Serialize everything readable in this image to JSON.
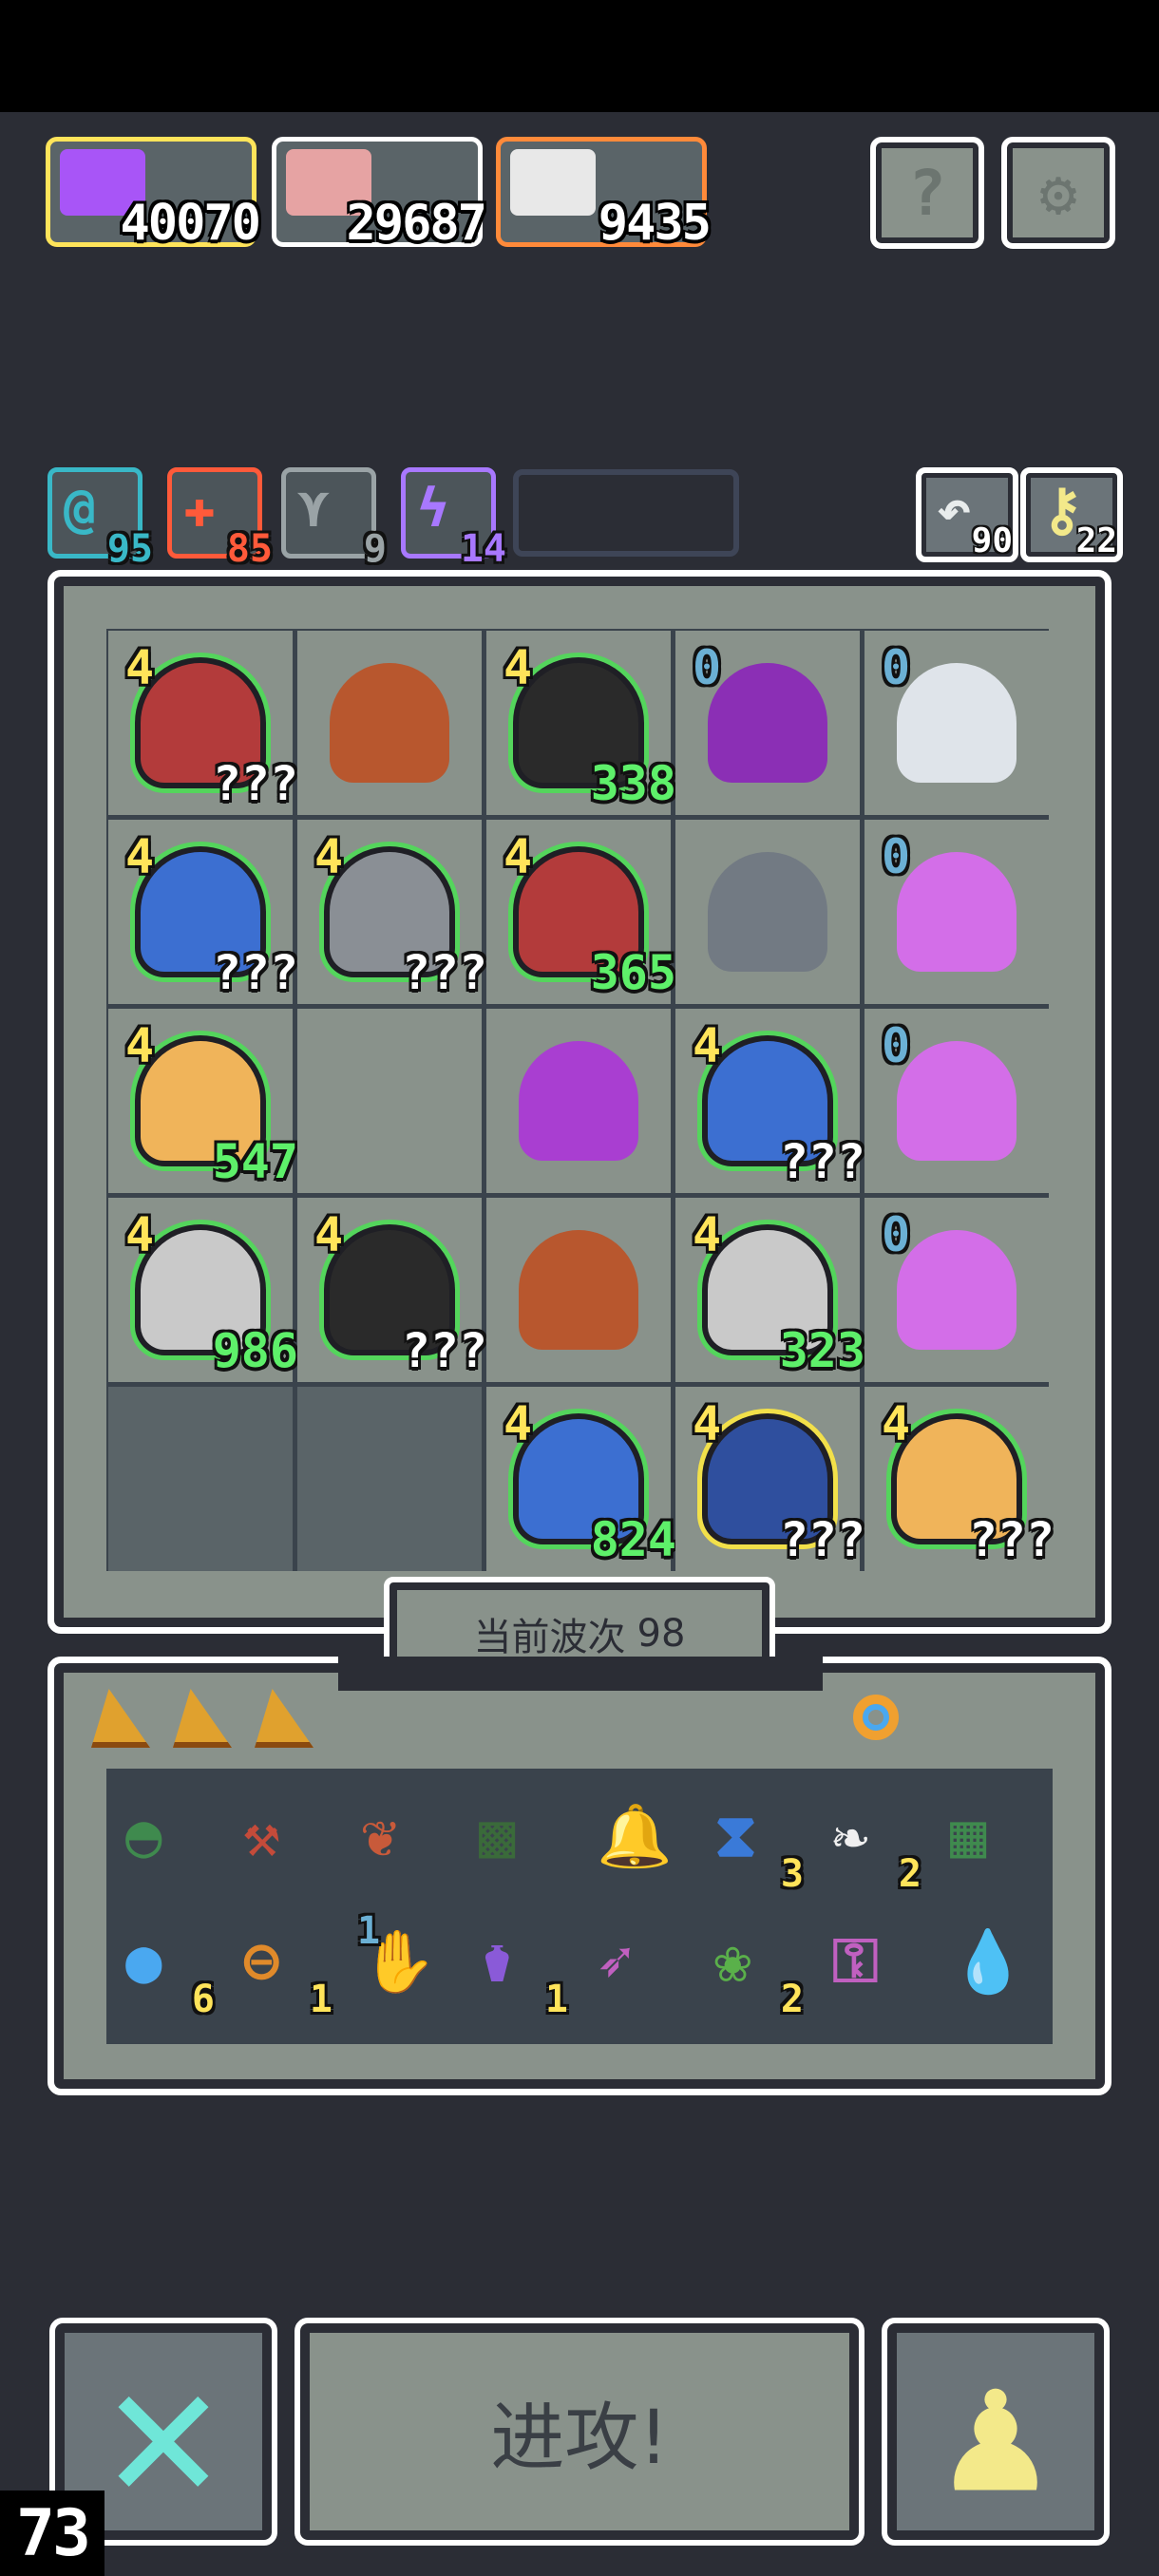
{
  "resources": [
    {
      "icon": "lightning-icon",
      "value": "40070",
      "border": "#ffe45a",
      "color": "#a855f7"
    },
    {
      "icon": "hero-portrait-icon",
      "value": "29687",
      "border": "#ffffff",
      "color": "#e6a3a3"
    },
    {
      "icon": "glove-icon",
      "value": "9435",
      "border": "#ff8a3a",
      "color": "#e8e8e8"
    }
  ],
  "buffs": [
    {
      "icon": "at-sign-icon",
      "glyph": "@",
      "value": "95",
      "color": "#39b8c7"
    },
    {
      "icon": "plus-icon",
      "glyph": "✚",
      "value": "85",
      "color": "#ff5a3a"
    },
    {
      "icon": "wing-icon",
      "glyph": "⋎",
      "value": "9",
      "color": "#9aa3a6"
    },
    {
      "icon": "bolt-icon",
      "glyph": "ϟ",
      "value": "14",
      "color": "#a878ff"
    }
  ],
  "counters": [
    {
      "icon": "undo-icon",
      "glyph": "↶",
      "value": "90"
    },
    {
      "icon": "key-icon",
      "glyph": "⚷",
      "value": "22"
    }
  ],
  "board": {
    "cells": [
      {
        "level": "4",
        "level_color": "yellow",
        "unit": "red-cloak-bandit",
        "unit_color": "#b33b3b",
        "value": "???",
        "value_color": "white",
        "outline": "green"
      },
      {
        "level": "",
        "unit": "leaf-bush",
        "unit_color": "#b8572e",
        "value": "",
        "outline": "none"
      },
      {
        "level": "4",
        "level_color": "yellow",
        "unit": "dark-hair-mage",
        "unit_color": "#2a2a2a",
        "value": "338",
        "value_color": "green",
        "outline": "green"
      },
      {
        "level": "0",
        "level_color": "blue",
        "unit": "purple-dragon",
        "unit_color": "#8b2fb5",
        "value": "",
        "outline": "none"
      },
      {
        "level": "0",
        "level_color": "blue",
        "unit": "white-hair-witch",
        "unit_color": "#dfe4ea",
        "value": "",
        "outline": "none"
      },
      {
        "level": "4",
        "level_color": "yellow",
        "unit": "blue-hooded-mage",
        "unit_color": "#3c6fd1",
        "value": "???",
        "value_color": "white",
        "outline": "green"
      },
      {
        "level": "4",
        "level_color": "yellow",
        "unit": "armored-knight",
        "unit_color": "#8a8f95",
        "value": "???",
        "value_color": "white",
        "outline": "green"
      },
      {
        "level": "4",
        "level_color": "yellow",
        "unit": "red-cloak-bandit",
        "unit_color": "#b33b3b",
        "value": "365",
        "value_color": "green",
        "outline": "green"
      },
      {
        "level": "",
        "unit": "stone-statue",
        "unit_color": "#727a83",
        "value": "",
        "outline": "none"
      },
      {
        "level": "0",
        "level_color": "blue",
        "unit": "purple-demon",
        "unit_color": "#d36ee8",
        "value": "",
        "outline": "none"
      },
      {
        "level": "4",
        "level_color": "yellow",
        "unit": "golden-golem",
        "unit_color": "#f0b45a",
        "value": "547",
        "value_color": "green",
        "outline": "green"
      },
      {
        "level": "",
        "unit": "",
        "value": "",
        "outline": "none"
      },
      {
        "level": "",
        "unit": "purple-demon",
        "unit_color": "#a93ed1",
        "value": "",
        "outline": "none"
      },
      {
        "level": "4",
        "level_color": "yellow",
        "unit": "blue-hooded-mage",
        "unit_color": "#3c6fd1",
        "value": "???",
        "value_color": "white",
        "outline": "green"
      },
      {
        "level": "0",
        "level_color": "blue",
        "unit": "purple-demon",
        "unit_color": "#d36ee8",
        "value": "",
        "outline": "none"
      },
      {
        "level": "4",
        "level_color": "yellow",
        "unit": "silver-hair-girl",
        "unit_color": "#c9c9c9",
        "value": "986",
        "value_color": "green",
        "outline": "green"
      },
      {
        "level": "4",
        "level_color": "yellow",
        "unit": "dark-hair-mage",
        "unit_color": "#2a2a2a",
        "value": "???",
        "value_color": "white",
        "outline": "green"
      },
      {
        "level": "",
        "unit": "leaf-bush",
        "unit_color": "#b8572e",
        "value": "",
        "outline": "none"
      },
      {
        "level": "4",
        "level_color": "yellow",
        "unit": "silver-hair-girl",
        "unit_color": "#c9c9c9",
        "value": "323",
        "value_color": "green",
        "outline": "green"
      },
      {
        "level": "0",
        "level_color": "blue",
        "unit": "purple-demon",
        "unit_color": "#d36ee8",
        "value": "",
        "outline": "none"
      },
      {
        "level": "",
        "unit": "",
        "value": "",
        "outline": "none",
        "dark": true
      },
      {
        "level": "",
        "unit": "",
        "value": "",
        "outline": "none",
        "dark": true
      },
      {
        "level": "4",
        "level_color": "yellow",
        "unit": "blue-hooded-mage",
        "unit_color": "#3c6fd1",
        "value": "824",
        "value_color": "green",
        "outline": "green"
      },
      {
        "level": "4",
        "level_color": "yellow",
        "unit": "staff-priestess",
        "unit_color": "#2f4f9e",
        "value": "???",
        "value_color": "white",
        "outline": "yellow"
      },
      {
        "level": "4",
        "level_color": "yellow",
        "unit": "golden-golem",
        "unit_color": "#f0b45a",
        "value": "???",
        "value_color": "white",
        "outline": "green"
      }
    ]
  },
  "wave": {
    "label": "当前波次",
    "number": "98"
  },
  "slots": [
    {
      "icon": "shard-icon",
      "color": "#e0a12e"
    },
    {
      "icon": "shard-icon",
      "color": "#e0a12e"
    },
    {
      "icon": "shard-icon",
      "color": "#e0a12e"
    }
  ],
  "ring_icon": "ring-icon",
  "items": [
    {
      "icon": "green-helmet-icon",
      "glyph": "◓",
      "color": "#3f8a4e",
      "count": "",
      "tier": ""
    },
    {
      "icon": "hammer-icon",
      "glyph": "⚒",
      "color": "#c44b3a",
      "count": "",
      "tier": ""
    },
    {
      "icon": "red-leaf-icon",
      "glyph": "❦",
      "color": "#c85a3a",
      "count": "",
      "tier": ""
    },
    {
      "icon": "rune-stone-icon",
      "glyph": "▩",
      "color": "#3a6a3a",
      "count": "",
      "tier": ""
    },
    {
      "icon": "bell-icon",
      "glyph": "🔔",
      "color": "#2a4a4a",
      "count": "",
      "tier": ""
    },
    {
      "icon": "hourglass-icon",
      "glyph": "⧗",
      "color": "#3a7ad8",
      "count": "3",
      "tier": ""
    },
    {
      "icon": "white-wing-icon",
      "glyph": "❧",
      "color": "#f0f0f0",
      "count": "2",
      "tier": ""
    },
    {
      "icon": "green-map-icon",
      "glyph": "▦",
      "color": "#3f8a4e",
      "count": "",
      "tier": ""
    },
    {
      "icon": "blue-orb-icon",
      "glyph": "●",
      "color": "#4aa8f0",
      "count": "6",
      "tier": ""
    },
    {
      "icon": "compass-icon",
      "glyph": "⊖",
      "color": "#e08a2a",
      "count": "1",
      "tier": ""
    },
    {
      "icon": "palm-eye-icon",
      "glyph": "✋",
      "color": "#f0b0b0",
      "count": "",
      "tier": "1"
    },
    {
      "icon": "potion-jar-icon",
      "glyph": "⚱",
      "color": "#8a5ad8",
      "count": "1",
      "tier": ""
    },
    {
      "icon": "arrow-icon",
      "glyph": "➶",
      "color": "#c060c0",
      "count": "",
      "tier": ""
    },
    {
      "icon": "green-root-icon",
      "glyph": "❀",
      "color": "#5ab04a",
      "count": "2",
      "tier": ""
    },
    {
      "icon": "golden-key-icon",
      "glyph": "⚿",
      "color": "#c060c0",
      "count": "",
      "tier": ""
    },
    {
      "icon": "water-drop-icon",
      "glyph": "💧",
      "color": "#4a7ad8",
      "count": "",
      "tier": ""
    }
  ],
  "actions": {
    "cancel_icon": "cross-icon",
    "attack_label": "进攻!",
    "pawn_icon": "pawn-icon"
  },
  "fps": "73"
}
